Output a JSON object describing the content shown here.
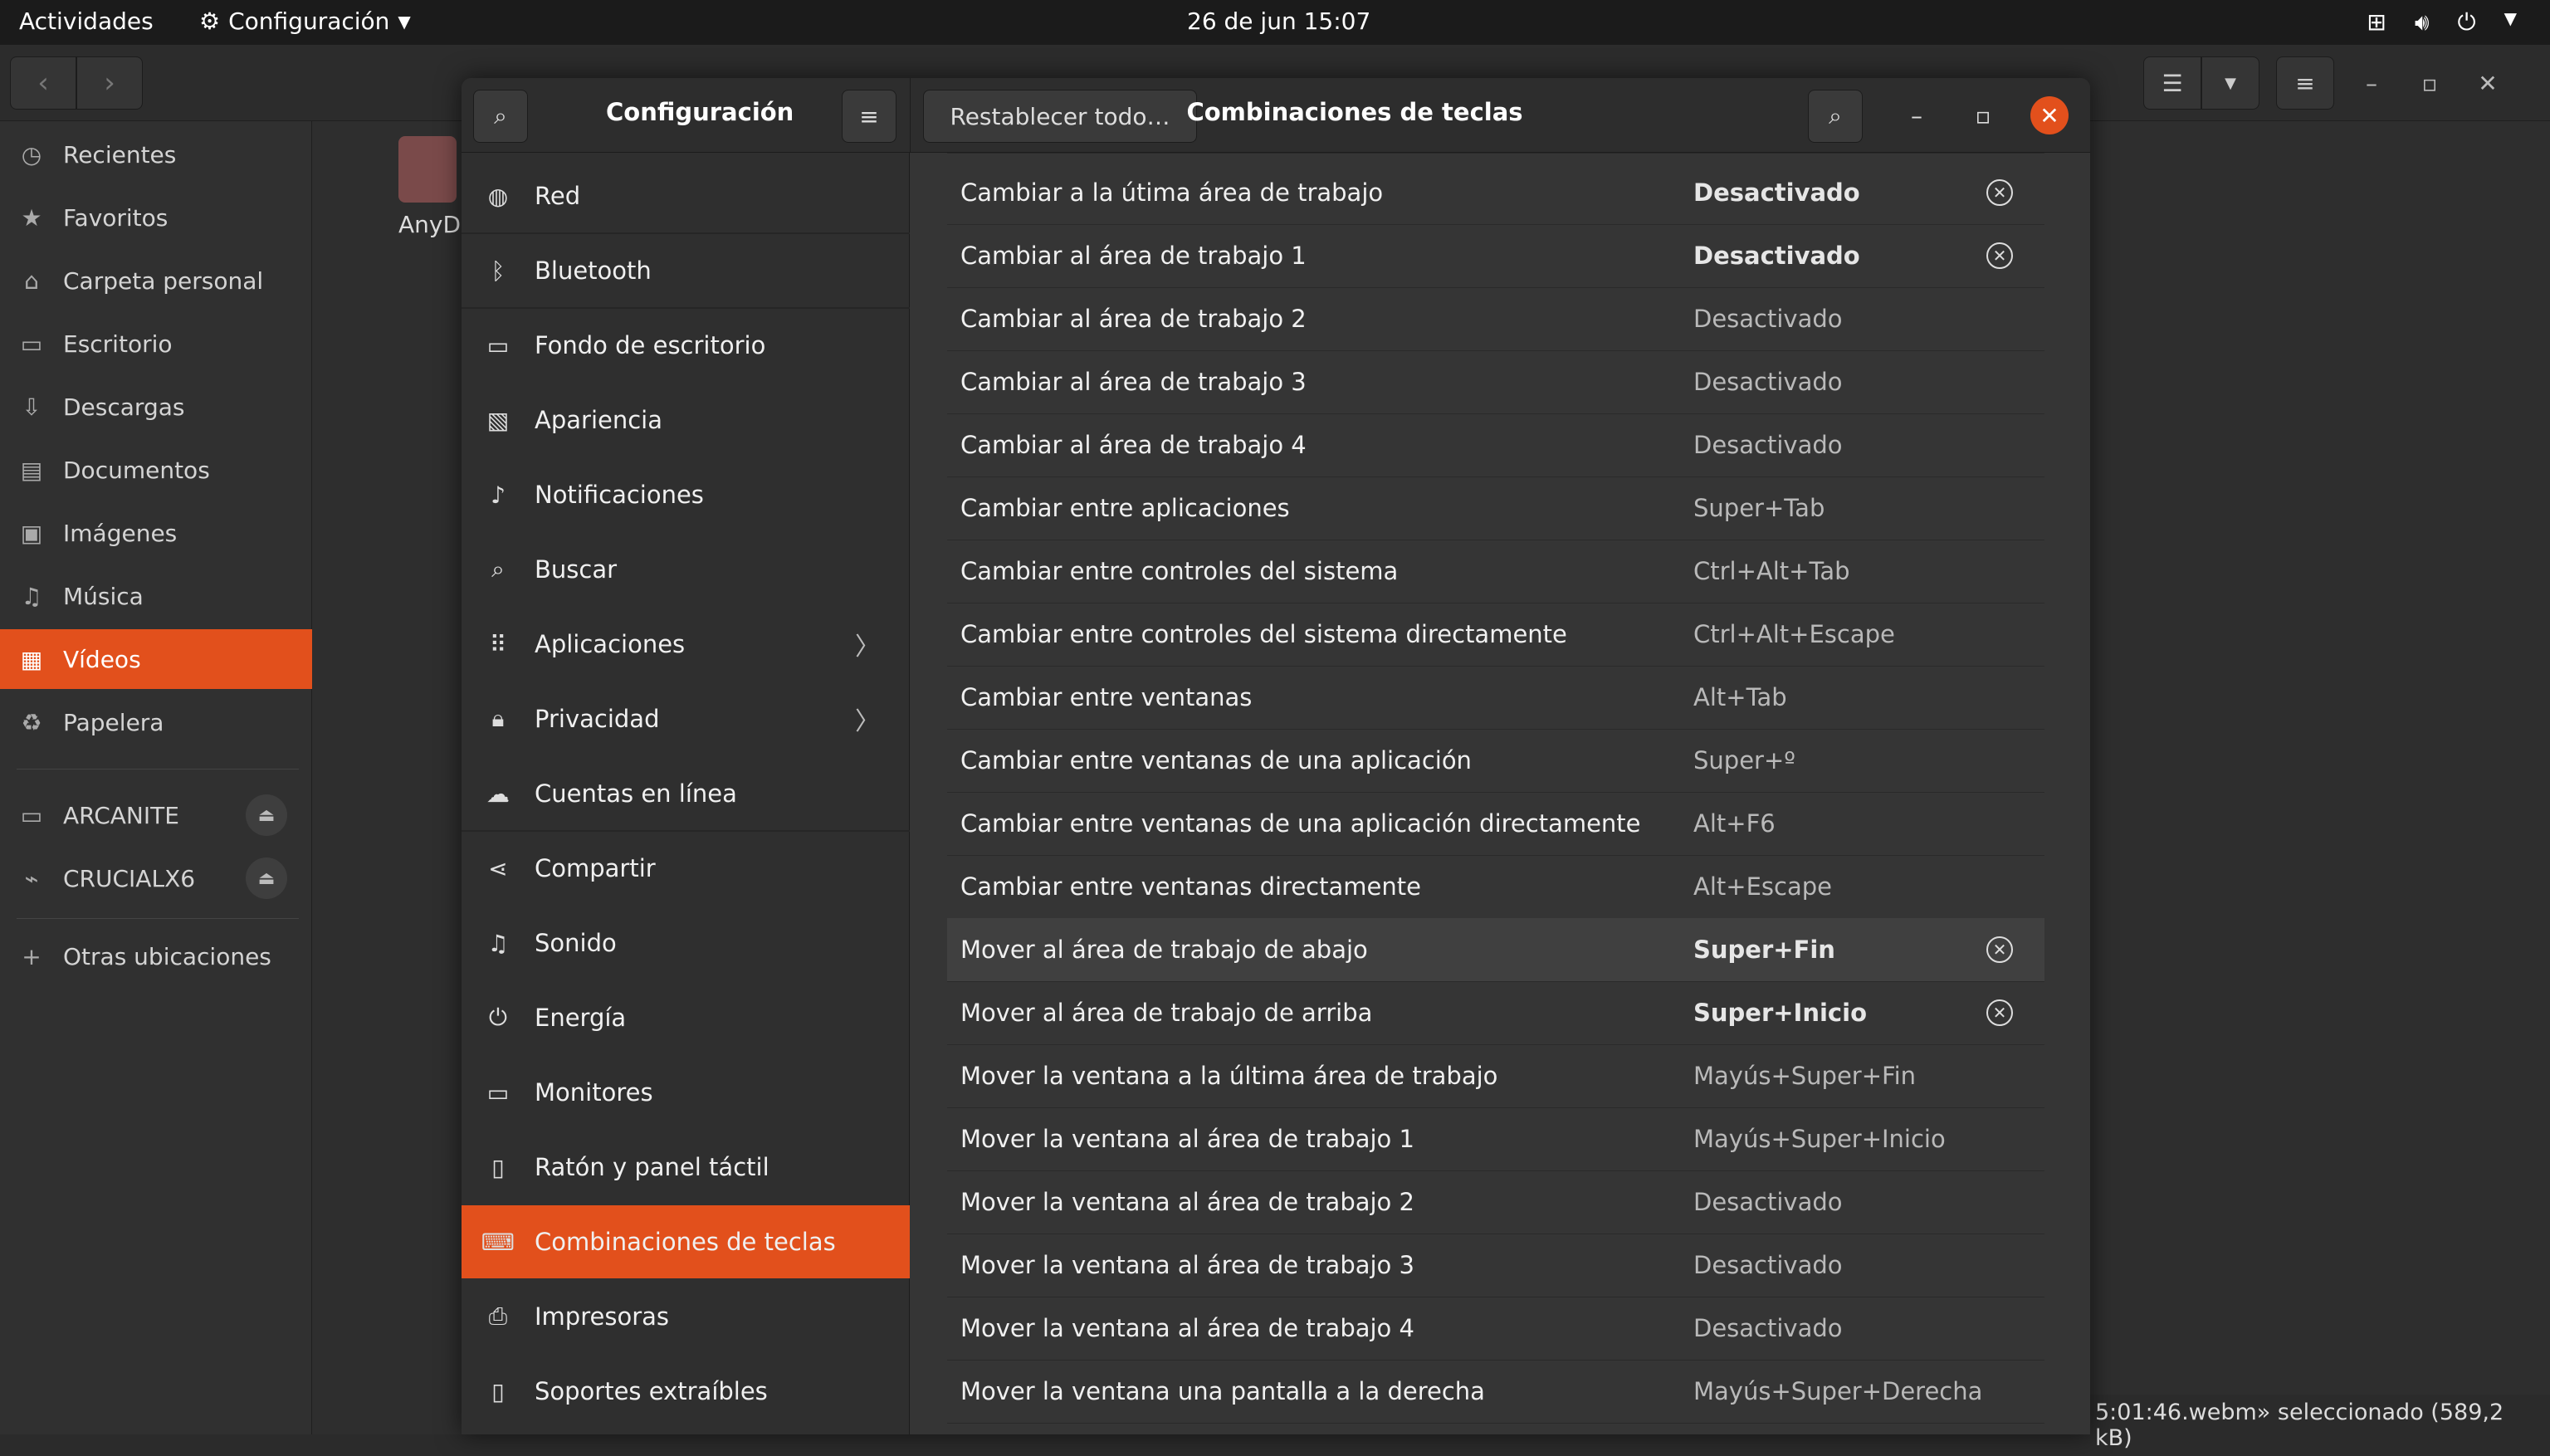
{
  "topbar": {
    "activities": "Actividades",
    "app_name": "Configuración",
    "clock": "26 de jun  15:07"
  },
  "filemanager": {
    "places": [
      {
        "label": "Recientes",
        "icon": "clock-icon",
        "glyph": "◷"
      },
      {
        "label": "Favoritos",
        "icon": "star-icon",
        "glyph": "★"
      },
      {
        "label": "Carpeta personal",
        "icon": "home-icon",
        "glyph": "⌂"
      },
      {
        "label": "Escritorio",
        "icon": "desktop-icon",
        "glyph": "▭"
      },
      {
        "label": "Descargas",
        "icon": "download-icon",
        "glyph": "⇩"
      },
      {
        "label": "Documentos",
        "icon": "document-icon",
        "glyph": "▤"
      },
      {
        "label": "Imágenes",
        "icon": "image-icon",
        "glyph": "▣"
      },
      {
        "label": "Música",
        "icon": "music-icon",
        "glyph": "♫"
      },
      {
        "label": "Vídeos",
        "icon": "video-icon",
        "glyph": "▦"
      },
      {
        "label": "Papelera",
        "icon": "trash-icon",
        "glyph": "♻"
      }
    ],
    "active_place": "Vídeos",
    "devices": [
      {
        "label": "ARCANITE",
        "icon": "drive-icon",
        "glyph": "▭"
      },
      {
        "label": "CRUCIALX6",
        "icon": "usb-icon",
        "glyph": "⌁"
      }
    ],
    "other": "Otras ubicaciones",
    "file_peek": "AnyDe",
    "status": "5:01:46.webm» seleccionado  (589,2 kB)"
  },
  "settings": {
    "left_title": "Configuración",
    "reset_label": "Restablecer todo…",
    "title": "Combinaciones de teclas",
    "nav": [
      {
        "label": "Red",
        "icon": "network-icon",
        "glyph": "◍",
        "chevron": false
      },
      {
        "label": "Bluetooth",
        "icon": "bluetooth-icon",
        "glyph": "ᛒ",
        "chevron": false
      },
      {
        "label": "Fondo de escritorio",
        "icon": "wallpaper-icon",
        "glyph": "▭",
        "chevron": false
      },
      {
        "label": "Apariencia",
        "icon": "appearance-icon",
        "glyph": "▧",
        "chevron": false
      },
      {
        "label": "Notificaciones",
        "icon": "bell-icon",
        "glyph": "♪",
        "chevron": false
      },
      {
        "label": "Buscar",
        "icon": "search-icon",
        "glyph": "⌕",
        "chevron": false
      },
      {
        "label": "Aplicaciones",
        "icon": "apps-icon",
        "glyph": "⠿",
        "chevron": true
      },
      {
        "label": "Privacidad",
        "icon": "lock-icon",
        "glyph": "🔒︎",
        "chevron": true
      },
      {
        "label": "Cuentas en línea",
        "icon": "cloud-icon",
        "glyph": "☁",
        "chevron": false
      },
      {
        "label": "Compartir",
        "icon": "share-icon",
        "glyph": "⋖",
        "chevron": false
      },
      {
        "label": "Sonido",
        "icon": "sound-icon",
        "glyph": "♫",
        "chevron": false
      },
      {
        "label": "Energía",
        "icon": "power-icon",
        "glyph": "⏻",
        "chevron": false
      },
      {
        "label": "Monitores",
        "icon": "monitor-icon",
        "glyph": "▭",
        "chevron": false
      },
      {
        "label": "Ratón y panel táctil",
        "icon": "mouse-icon",
        "glyph": "▯",
        "chevron": false
      },
      {
        "label": "Combinaciones de teclas",
        "icon": "keyboard-icon",
        "glyph": "⌨",
        "chevron": false
      },
      {
        "label": "Impresoras",
        "icon": "printer-icon",
        "glyph": "⎙",
        "chevron": false
      },
      {
        "label": "Soportes extraíbles",
        "icon": "removable-media-icon",
        "glyph": "▯",
        "chevron": false
      }
    ],
    "active_nav": "Combinaciones de teclas",
    "shortcuts": [
      {
        "name": "Cambiar a la útima área de trabajo",
        "accel": "Desactivado",
        "custom": true
      },
      {
        "name": "Cambiar al área de trabajo 1",
        "accel": "Desactivado",
        "custom": true
      },
      {
        "name": "Cambiar al área de trabajo 2",
        "accel": "Desactivado",
        "custom": false
      },
      {
        "name": "Cambiar al área de trabajo 3",
        "accel": "Desactivado",
        "custom": false
      },
      {
        "name": "Cambiar al área de trabajo 4",
        "accel": "Desactivado",
        "custom": false
      },
      {
        "name": "Cambiar entre aplicaciones",
        "accel": "Super+Tab",
        "custom": false
      },
      {
        "name": "Cambiar entre controles del sistema",
        "accel": "Ctrl+Alt+Tab",
        "custom": false
      },
      {
        "name": "Cambiar entre controles del sistema directamente",
        "accel": "Ctrl+Alt+Escape",
        "custom": false
      },
      {
        "name": "Cambiar entre ventanas",
        "accel": "Alt+Tab",
        "custom": false
      },
      {
        "name": "Cambiar entre ventanas de una aplicación",
        "accel": "Super+º",
        "custom": false
      },
      {
        "name": "Cambiar entre ventanas de una aplicación directamente",
        "accel": "Alt+F6",
        "custom": false
      },
      {
        "name": "Cambiar entre ventanas directamente",
        "accel": "Alt+Escape",
        "custom": false
      },
      {
        "name": "Mover al área de trabajo de abajo",
        "accel": "Super+Fin",
        "custom": true,
        "highlight": true
      },
      {
        "name": "Mover al área de trabajo de arriba",
        "accel": "Super+Inicio",
        "custom": true
      },
      {
        "name": "Mover la ventana a la última área de trabajo",
        "accel": "Mayús+Super+Fin",
        "custom": false
      },
      {
        "name": "Mover la ventana al área de trabajo 1",
        "accel": "Mayús+Super+Inicio",
        "custom": false
      },
      {
        "name": "Mover la ventana al área de trabajo 2",
        "accel": "Desactivado",
        "custom": false
      },
      {
        "name": "Mover la ventana al área de trabajo 3",
        "accel": "Desactivado",
        "custom": false
      },
      {
        "name": "Mover la ventana al área de trabajo 4",
        "accel": "Desactivado",
        "custom": false
      },
      {
        "name": "Mover la ventana una pantalla a la derecha",
        "accel": "Mayús+Super+Derecha",
        "custom": false
      }
    ]
  },
  "colors": {
    "accent": "#e2501c",
    "bg": "#353535",
    "topbar": "#1b1b1b"
  }
}
